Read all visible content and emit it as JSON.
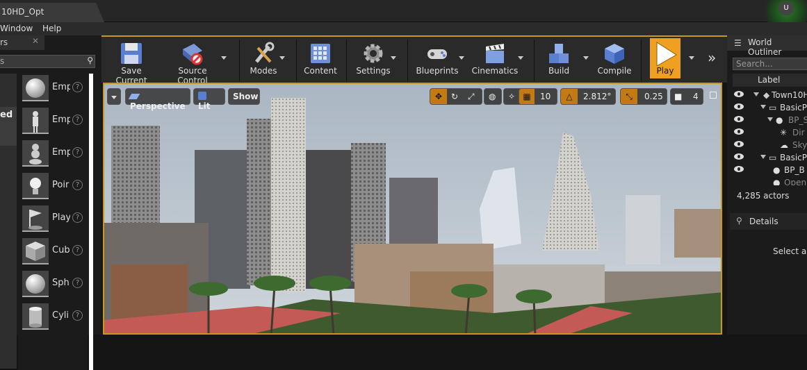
{
  "window": {
    "tab_title": "10HD_Opt",
    "logo_mark": "U"
  },
  "menu": {
    "items": [
      "Window",
      "Help"
    ]
  },
  "place_panel": {
    "tab_label": "rs",
    "search_value": "s",
    "category_selected": "ed",
    "items": [
      {
        "label": "Emp",
        "icon": "sphere-icon"
      },
      {
        "label": "Emp",
        "icon": "character-icon"
      },
      {
        "label": "Emp",
        "icon": "pawn-icon"
      },
      {
        "label": "Poir",
        "icon": "point-light-icon"
      },
      {
        "label": "Play",
        "icon": "player-start-icon"
      },
      {
        "label": "Cub",
        "icon": "cube-icon"
      },
      {
        "label": "Sph",
        "icon": "sphere-icon"
      },
      {
        "label": "Cyli",
        "icon": "cylinder-icon"
      }
    ],
    "help_glyph": "?"
  },
  "toolbar": {
    "save_current": "Save Current",
    "source_control": "Source Control",
    "modes": "Modes",
    "content": "Content",
    "settings": "Settings",
    "blueprints": "Blueprints",
    "cinematics": "Cinematics",
    "build": "Build",
    "compile": "Compile",
    "play": "Play",
    "more": "»"
  },
  "viewport": {
    "perspective": "Perspective",
    "lit": "Lit",
    "show": "Show",
    "grid_snap": "10",
    "rotation_snap": "2.812°",
    "scale_snap": "0.25",
    "camera_speed": "4"
  },
  "outliner": {
    "title": "World Outliner",
    "search_placeholder": "Search...",
    "column_label": "Label",
    "rows": [
      "Town10H",
      "BasicP",
      "BP_S",
      "Dir",
      "Sky",
      "BasicP",
      "BP_B",
      "Open"
    ],
    "actor_count": "4,285 actors"
  },
  "details": {
    "title": "Details",
    "hint": "Select an"
  },
  "colors": {
    "accent": "#c69a1a",
    "play": "#f0a020",
    "panel": "#1b1b1b"
  }
}
